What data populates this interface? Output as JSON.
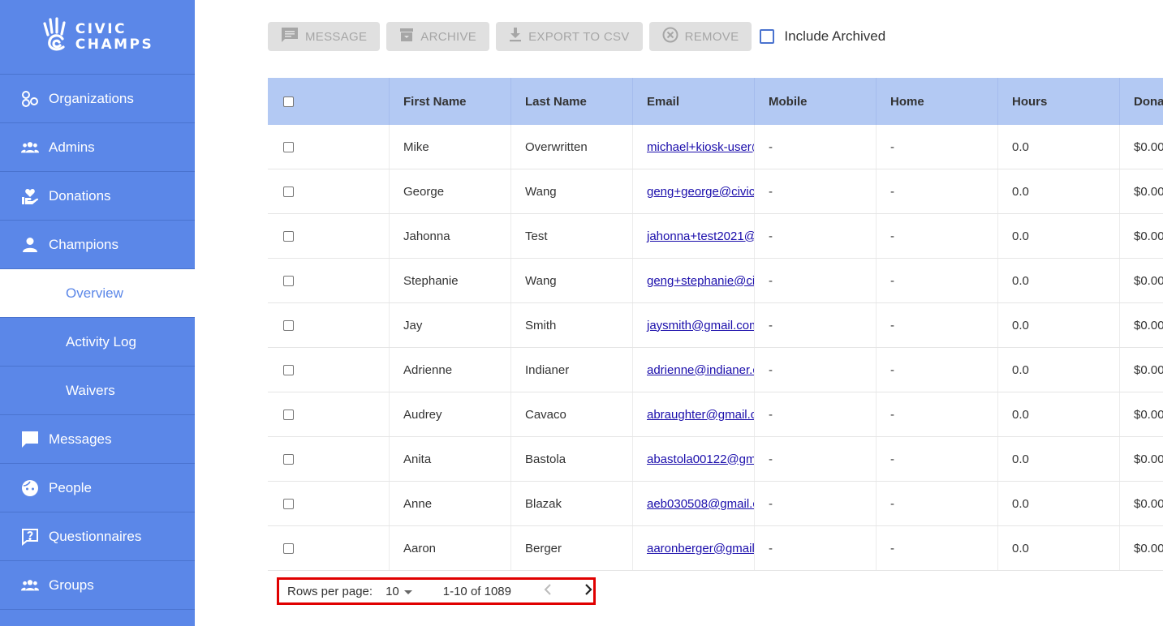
{
  "sidebar": {
    "logo_line1": "CIVIC",
    "logo_line2": "CHAMPS",
    "items": [
      {
        "label": "Organizations"
      },
      {
        "label": "Admins"
      },
      {
        "label": "Donations"
      },
      {
        "label": "Champions"
      },
      {
        "label": "Overview"
      },
      {
        "label": "Activity Log"
      },
      {
        "label": "Waivers"
      },
      {
        "label": "Messages"
      },
      {
        "label": "People"
      },
      {
        "label": "Questionnaires"
      },
      {
        "label": "Groups"
      }
    ]
  },
  "toolbar": {
    "message": "MESSAGE",
    "archive": "ARCHIVE",
    "export": "EXPORT TO CSV",
    "remove": "REMOVE",
    "include_archived": "Include Archived"
  },
  "table": {
    "columns": [
      "First Name",
      "Last Name",
      "Email",
      "Mobile",
      "Home",
      "Hours",
      "Dona"
    ],
    "rows": [
      {
        "first": "Mike",
        "last": "Overwritten",
        "email": "michael+kiosk-user@",
        "mobile": "-",
        "home": "-",
        "hours": "0.0",
        "donations": "$0.00"
      },
      {
        "first": "George",
        "last": "Wang",
        "email": "geng+george@civicc",
        "mobile": "-",
        "home": "-",
        "hours": "0.0",
        "donations": "$0.00"
      },
      {
        "first": "Jahonna",
        "last": "Test",
        "email": "jahonna+test2021@c",
        "mobile": "-",
        "home": "-",
        "hours": "0.0",
        "donations": "$0.00"
      },
      {
        "first": "Stephanie",
        "last": "Wang",
        "email": "geng+stephanie@civ",
        "mobile": "-",
        "home": "-",
        "hours": "0.0",
        "donations": "$0.00"
      },
      {
        "first": "Jay",
        "last": "Smith",
        "email": "jaysmith@gmail.com",
        "mobile": "-",
        "home": "-",
        "hours": "0.0",
        "donations": "$0.00"
      },
      {
        "first": "Adrienne",
        "last": "Indianer",
        "email": "adrienne@indianer.c",
        "mobile": "-",
        "home": "-",
        "hours": "0.0",
        "donations": "$0.00"
      },
      {
        "first": "Audrey",
        "last": "Cavaco",
        "email": "abraughter@gmail.c",
        "mobile": "-",
        "home": "-",
        "hours": "0.0",
        "donations": "$0.00"
      },
      {
        "first": "Anita",
        "last": "Bastola",
        "email": "abastola00122@gma",
        "mobile": "-",
        "home": "-",
        "hours": "0.0",
        "donations": "$0.00"
      },
      {
        "first": "Anne",
        "last": "Blazak",
        "email": "aeb030508@gmail.c",
        "mobile": "-",
        "home": "-",
        "hours": "0.0",
        "donations": "$0.00"
      },
      {
        "first": "Aaron",
        "last": "Berger",
        "email": "aaronberger@gmail.",
        "mobile": "-",
        "home": "-",
        "hours": "0.0",
        "donations": "$0.00"
      }
    ]
  },
  "pagination": {
    "rows_label": "Rows per page:",
    "rows_value": "10",
    "range": "1-10 of 1089"
  },
  "colors": {
    "sidebar": "#5b87e8",
    "table_header": "#b3c9f3",
    "highlight": "#e00000"
  }
}
